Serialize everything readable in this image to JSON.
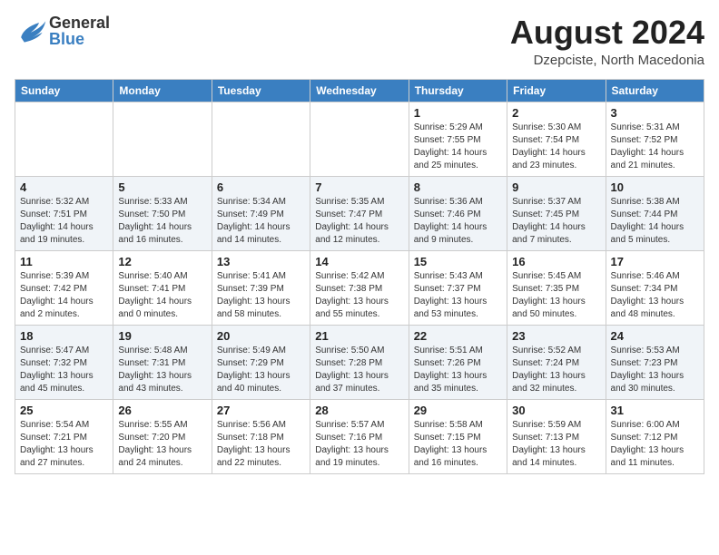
{
  "header": {
    "logo_general": "General",
    "logo_blue": "Blue",
    "month_year": "August 2024",
    "location": "Dzepciste, North Macedonia"
  },
  "calendar": {
    "days_of_week": [
      "Sunday",
      "Monday",
      "Tuesday",
      "Wednesday",
      "Thursday",
      "Friday",
      "Saturday"
    ],
    "weeks": [
      [
        {
          "day": "",
          "detail": ""
        },
        {
          "day": "",
          "detail": ""
        },
        {
          "day": "",
          "detail": ""
        },
        {
          "day": "",
          "detail": ""
        },
        {
          "day": "1",
          "detail": "Sunrise: 5:29 AM\nSunset: 7:55 PM\nDaylight: 14 hours\nand 25 minutes."
        },
        {
          "day": "2",
          "detail": "Sunrise: 5:30 AM\nSunset: 7:54 PM\nDaylight: 14 hours\nand 23 minutes."
        },
        {
          "day": "3",
          "detail": "Sunrise: 5:31 AM\nSunset: 7:52 PM\nDaylight: 14 hours\nand 21 minutes."
        }
      ],
      [
        {
          "day": "4",
          "detail": "Sunrise: 5:32 AM\nSunset: 7:51 PM\nDaylight: 14 hours\nand 19 minutes."
        },
        {
          "day": "5",
          "detail": "Sunrise: 5:33 AM\nSunset: 7:50 PM\nDaylight: 14 hours\nand 16 minutes."
        },
        {
          "day": "6",
          "detail": "Sunrise: 5:34 AM\nSunset: 7:49 PM\nDaylight: 14 hours\nand 14 minutes."
        },
        {
          "day": "7",
          "detail": "Sunrise: 5:35 AM\nSunset: 7:47 PM\nDaylight: 14 hours\nand 12 minutes."
        },
        {
          "day": "8",
          "detail": "Sunrise: 5:36 AM\nSunset: 7:46 PM\nDaylight: 14 hours\nand 9 minutes."
        },
        {
          "day": "9",
          "detail": "Sunrise: 5:37 AM\nSunset: 7:45 PM\nDaylight: 14 hours\nand 7 minutes."
        },
        {
          "day": "10",
          "detail": "Sunrise: 5:38 AM\nSunset: 7:44 PM\nDaylight: 14 hours\nand 5 minutes."
        }
      ],
      [
        {
          "day": "11",
          "detail": "Sunrise: 5:39 AM\nSunset: 7:42 PM\nDaylight: 14 hours\nand 2 minutes."
        },
        {
          "day": "12",
          "detail": "Sunrise: 5:40 AM\nSunset: 7:41 PM\nDaylight: 14 hours\nand 0 minutes."
        },
        {
          "day": "13",
          "detail": "Sunrise: 5:41 AM\nSunset: 7:39 PM\nDaylight: 13 hours\nand 58 minutes."
        },
        {
          "day": "14",
          "detail": "Sunrise: 5:42 AM\nSunset: 7:38 PM\nDaylight: 13 hours\nand 55 minutes."
        },
        {
          "day": "15",
          "detail": "Sunrise: 5:43 AM\nSunset: 7:37 PM\nDaylight: 13 hours\nand 53 minutes."
        },
        {
          "day": "16",
          "detail": "Sunrise: 5:45 AM\nSunset: 7:35 PM\nDaylight: 13 hours\nand 50 minutes."
        },
        {
          "day": "17",
          "detail": "Sunrise: 5:46 AM\nSunset: 7:34 PM\nDaylight: 13 hours\nand 48 minutes."
        }
      ],
      [
        {
          "day": "18",
          "detail": "Sunrise: 5:47 AM\nSunset: 7:32 PM\nDaylight: 13 hours\nand 45 minutes."
        },
        {
          "day": "19",
          "detail": "Sunrise: 5:48 AM\nSunset: 7:31 PM\nDaylight: 13 hours\nand 43 minutes."
        },
        {
          "day": "20",
          "detail": "Sunrise: 5:49 AM\nSunset: 7:29 PM\nDaylight: 13 hours\nand 40 minutes."
        },
        {
          "day": "21",
          "detail": "Sunrise: 5:50 AM\nSunset: 7:28 PM\nDaylight: 13 hours\nand 37 minutes."
        },
        {
          "day": "22",
          "detail": "Sunrise: 5:51 AM\nSunset: 7:26 PM\nDaylight: 13 hours\nand 35 minutes."
        },
        {
          "day": "23",
          "detail": "Sunrise: 5:52 AM\nSunset: 7:24 PM\nDaylight: 13 hours\nand 32 minutes."
        },
        {
          "day": "24",
          "detail": "Sunrise: 5:53 AM\nSunset: 7:23 PM\nDaylight: 13 hours\nand 30 minutes."
        }
      ],
      [
        {
          "day": "25",
          "detail": "Sunrise: 5:54 AM\nSunset: 7:21 PM\nDaylight: 13 hours\nand 27 minutes."
        },
        {
          "day": "26",
          "detail": "Sunrise: 5:55 AM\nSunset: 7:20 PM\nDaylight: 13 hours\nand 24 minutes."
        },
        {
          "day": "27",
          "detail": "Sunrise: 5:56 AM\nSunset: 7:18 PM\nDaylight: 13 hours\nand 22 minutes."
        },
        {
          "day": "28",
          "detail": "Sunrise: 5:57 AM\nSunset: 7:16 PM\nDaylight: 13 hours\nand 19 minutes."
        },
        {
          "day": "29",
          "detail": "Sunrise: 5:58 AM\nSunset: 7:15 PM\nDaylight: 13 hours\nand 16 minutes."
        },
        {
          "day": "30",
          "detail": "Sunrise: 5:59 AM\nSunset: 7:13 PM\nDaylight: 13 hours\nand 14 minutes."
        },
        {
          "day": "31",
          "detail": "Sunrise: 6:00 AM\nSunset: 7:12 PM\nDaylight: 13 hours\nand 11 minutes."
        }
      ]
    ]
  }
}
